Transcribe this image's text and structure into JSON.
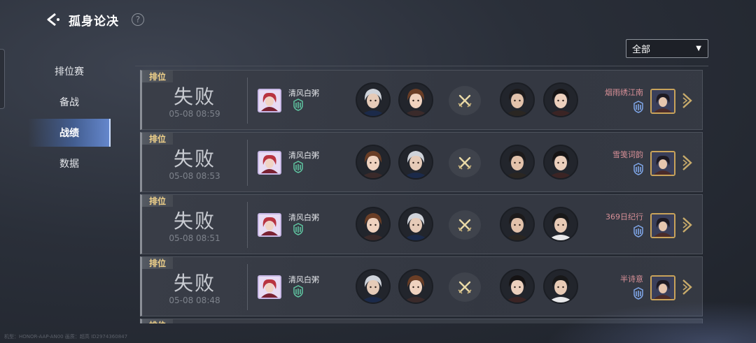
{
  "header": {
    "title": "孤身论决",
    "help_label": "?"
  },
  "filter": {
    "selected": "全部",
    "arrow": "▼"
  },
  "sidebar": {
    "items": [
      {
        "label": "排位赛",
        "active": false
      },
      {
        "label": "备战",
        "active": false
      },
      {
        "label": "战绩",
        "active": true
      },
      {
        "label": "数据",
        "active": false
      }
    ]
  },
  "matches": [
    {
      "tag": "排位",
      "result": "失败",
      "time": "05-08 08:59",
      "player": "清风白粥",
      "opponent": "烟雨绣江南",
      "team": [
        "silver-hair",
        "brown-hair"
      ],
      "enemy": [
        "dark-hair-male",
        "dark-hair-female"
      ]
    },
    {
      "tag": "排位",
      "result": "失败",
      "time": "05-08 08:53",
      "player": "清风白粥",
      "opponent": "雪笺词韵",
      "team": [
        "brown-hair",
        "silver-hair"
      ],
      "enemy": [
        "dark-hair-male",
        "dark-hair-female"
      ]
    },
    {
      "tag": "排位",
      "result": "失败",
      "time": "05-08 08:51",
      "player": "清风白粥",
      "opponent": "369日纪行",
      "team": [
        "brown-hair",
        "silver-hair"
      ],
      "enemy": [
        "dark-hair-male",
        "short-hair-male"
      ]
    },
    {
      "tag": "排位",
      "result": "失败",
      "time": "05-08 08:48",
      "player": "清风白粥",
      "opponent": "半诗意",
      "team": [
        "silver-hair",
        "brown-hair"
      ],
      "enemy": [
        "dark-hair-female",
        "short-hair-male"
      ]
    }
  ],
  "peek": {
    "tag": "排位"
  },
  "footer": {
    "text": "机型：HONOR-AAP-AN00 画质：超高 ID2974360847"
  },
  "colors": {
    "tag_text": "#f1d28a",
    "opponent_name": "#d89097",
    "accent": "#4e7acd"
  }
}
